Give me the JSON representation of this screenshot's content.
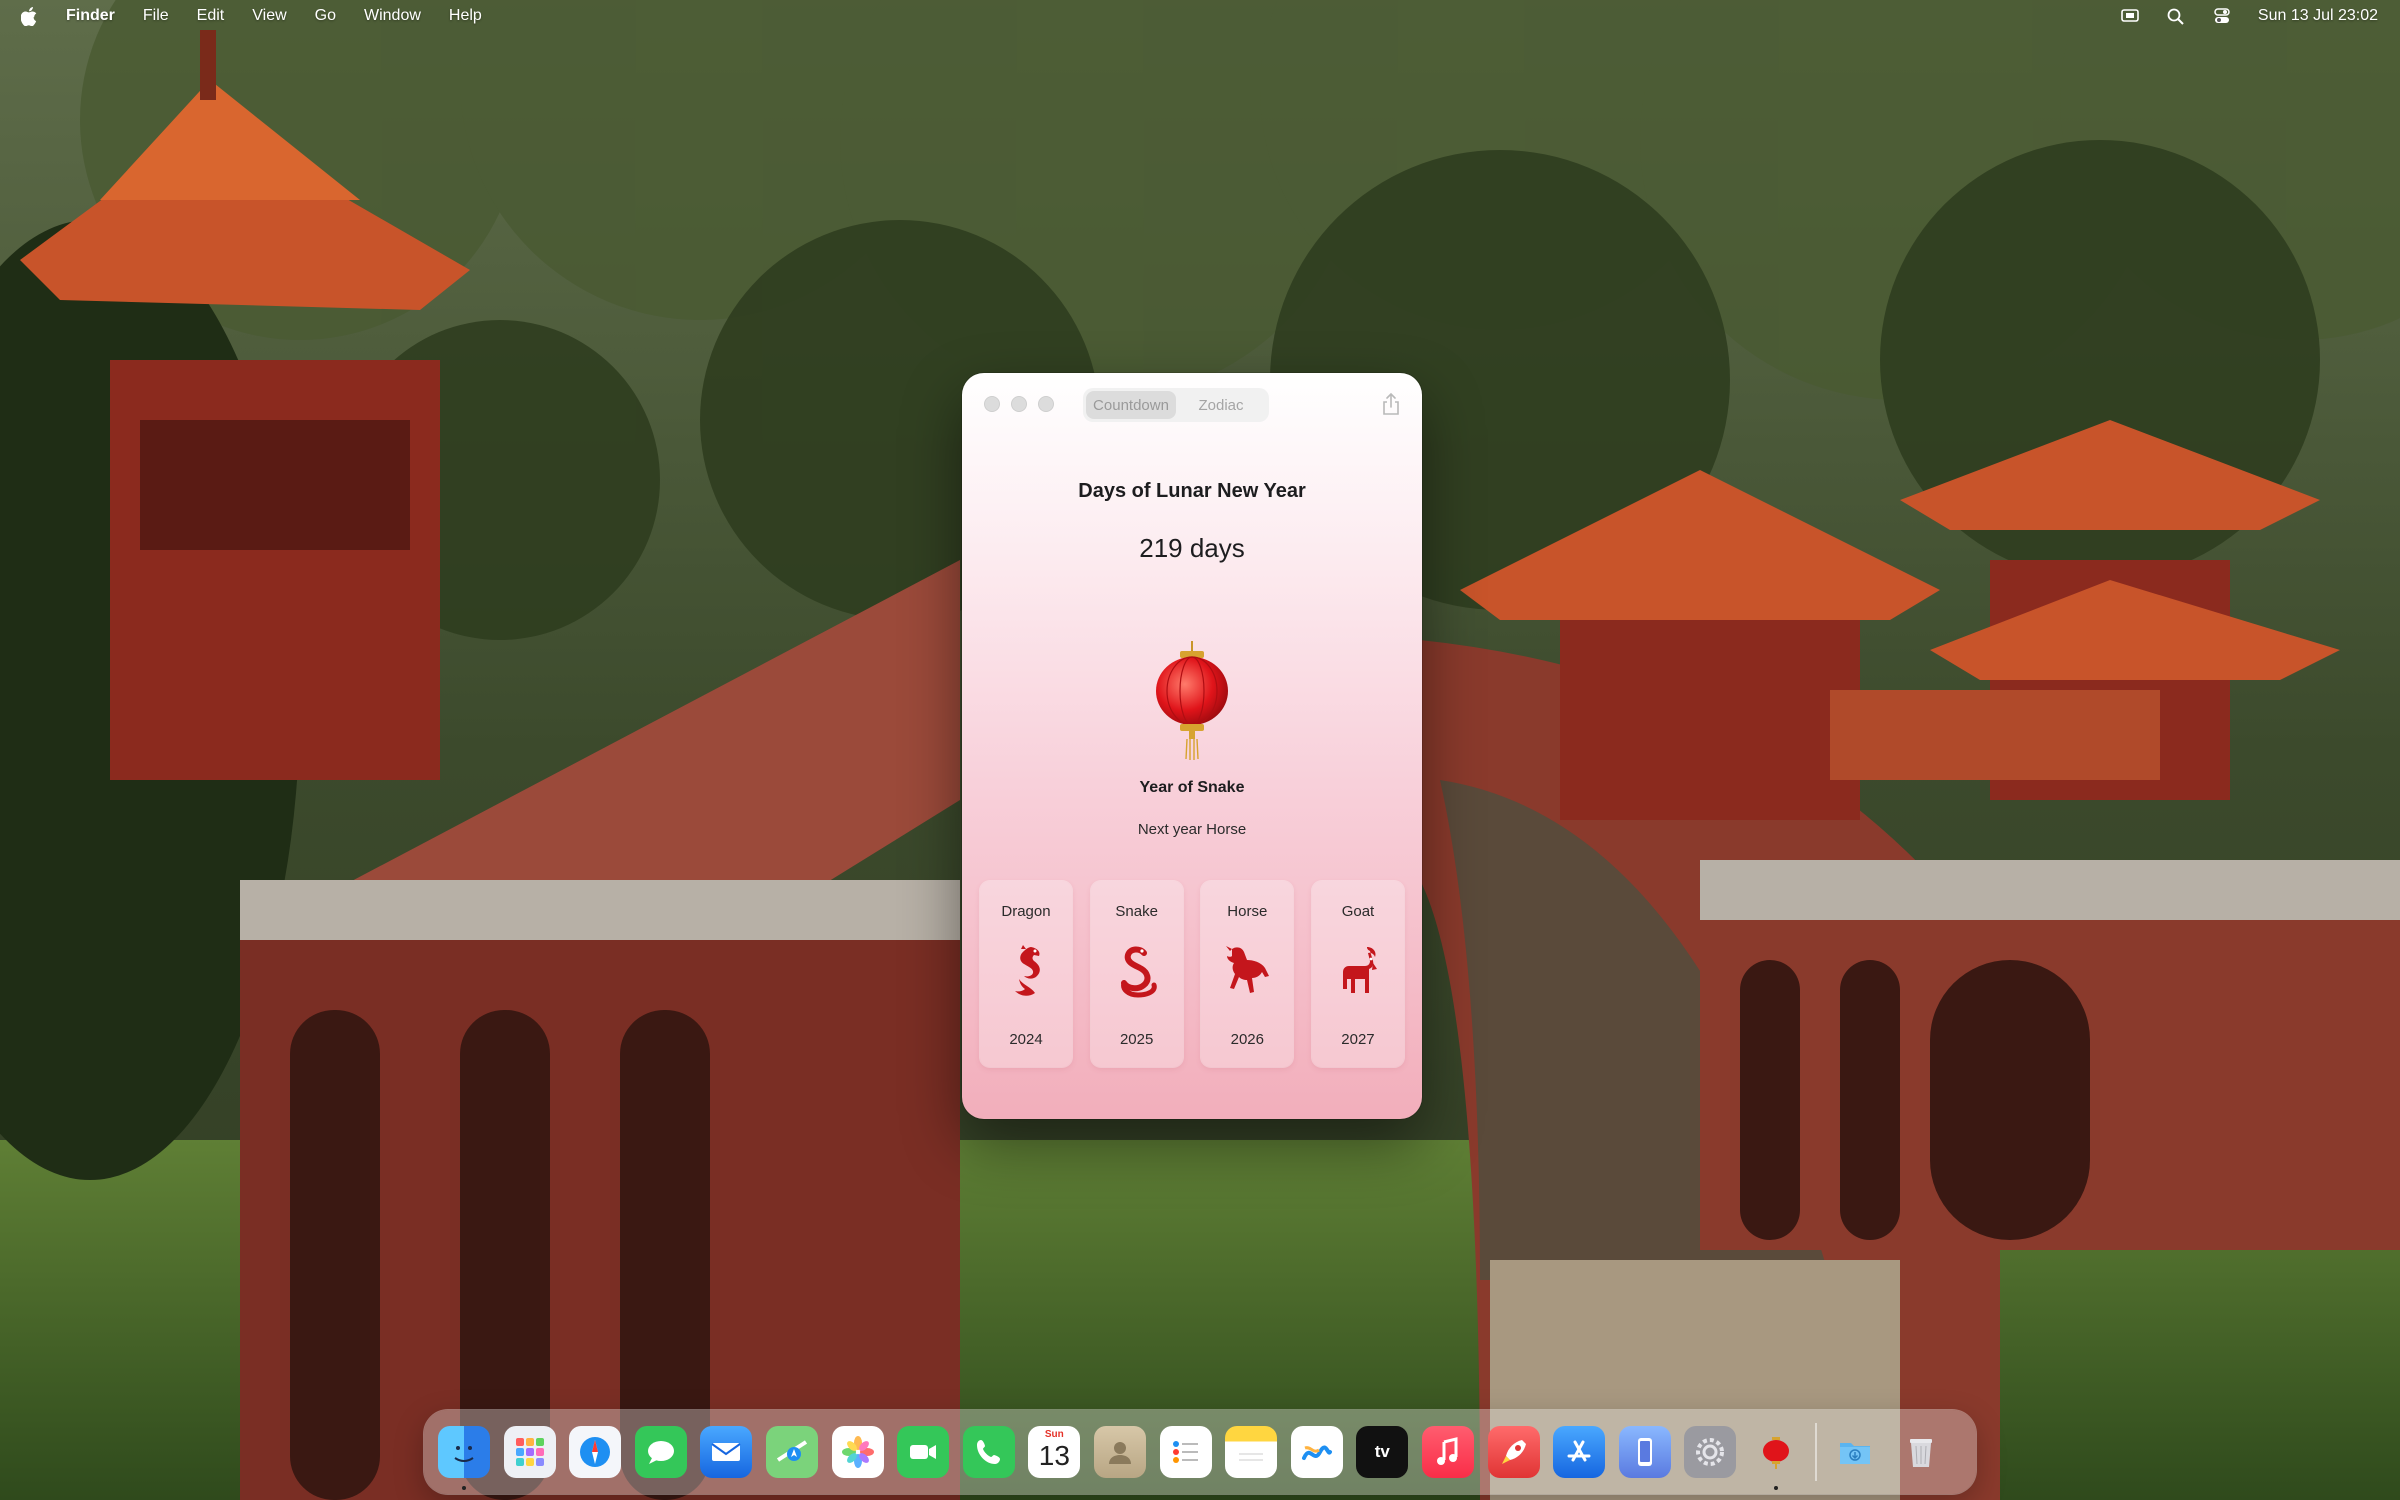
{
  "menubar": {
    "app_name": "Finder",
    "menus": [
      "File",
      "Edit",
      "View",
      "Go",
      "Window",
      "Help"
    ],
    "status_icons": [
      "screen-mirroring-icon",
      "search-icon",
      "control-center-icon"
    ],
    "clock": "Sun 13 Jul  23:02"
  },
  "widget": {
    "tabs": [
      {
        "label": "Countdown",
        "selected": true
      },
      {
        "label": "Zodiac",
        "selected": false
      }
    ],
    "heading": "Days of Lunar New Year",
    "days_remaining": "219 days",
    "current_year_label": "Year of Snake",
    "next_year_label": "Next year Horse",
    "zodiac_cards": [
      {
        "name": "Dragon",
        "year": "2024",
        "icon": "dragon-icon"
      },
      {
        "name": "Snake",
        "year": "2025",
        "icon": "snake-icon"
      },
      {
        "name": "Horse",
        "year": "2026",
        "icon": "horse-icon"
      },
      {
        "name": "Goat",
        "year": "2027",
        "icon": "goat-icon"
      }
    ],
    "colors": {
      "zodiac_red": "#c4161c",
      "gradient_top": "#ffffff",
      "gradient_bottom": "#f2aebb"
    }
  },
  "dock": {
    "apps": [
      "finder-icon",
      "launchpad-icon",
      "safari-icon",
      "messages-icon",
      "mail-icon",
      "maps-icon",
      "photos-icon",
      "facetime-icon",
      "phone-icon",
      "calendar-icon",
      "contacts-icon",
      "reminders-icon",
      "notes-icon",
      "freeform-icon",
      "apple-tv-icon",
      "music-icon",
      "rocket-icon",
      "app-store-icon",
      "iphone-mirroring-icon",
      "system-settings-icon",
      "lantern-app-icon"
    ],
    "calendar": {
      "month": "Sun",
      "day": "13"
    },
    "tv_label": "tv",
    "trailing": [
      "downloads-folder-icon",
      "trash-icon"
    ]
  }
}
